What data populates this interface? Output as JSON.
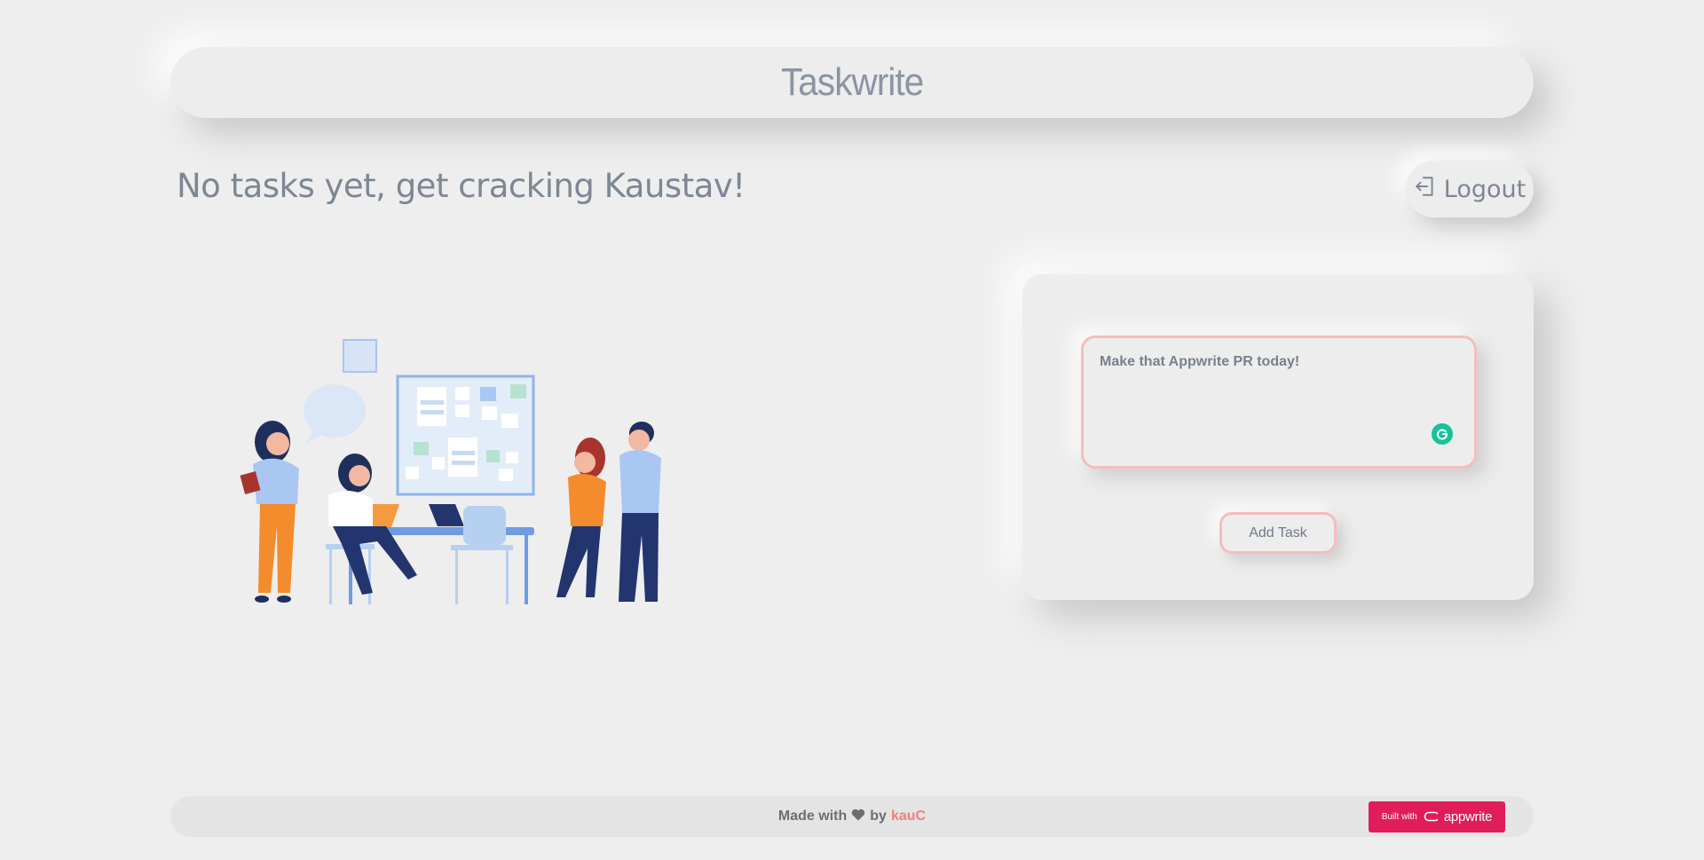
{
  "header": {
    "title": "Taskwrite"
  },
  "main": {
    "greeting": "No tasks yet, get cracking Kaustav!",
    "logout_label": "Logout",
    "logout_icon": "logout-icon"
  },
  "task_form": {
    "input_value": "Make that Appwrite PR today!",
    "add_button_label": "Add Task",
    "grammarly_icon": "grammarly-icon"
  },
  "footer": {
    "made_with": "Made with",
    "by": "by",
    "author": "kauC",
    "heart_icon": "heart-icon",
    "built_with_label": "Built with",
    "built_with_brand": "appwrite"
  },
  "colors": {
    "background": "#eeeeee",
    "accent_border": "#f5bdbd",
    "author_link": "#f08080",
    "appwrite_badge": "#e01d5a",
    "grammarly": "#15c39a"
  }
}
